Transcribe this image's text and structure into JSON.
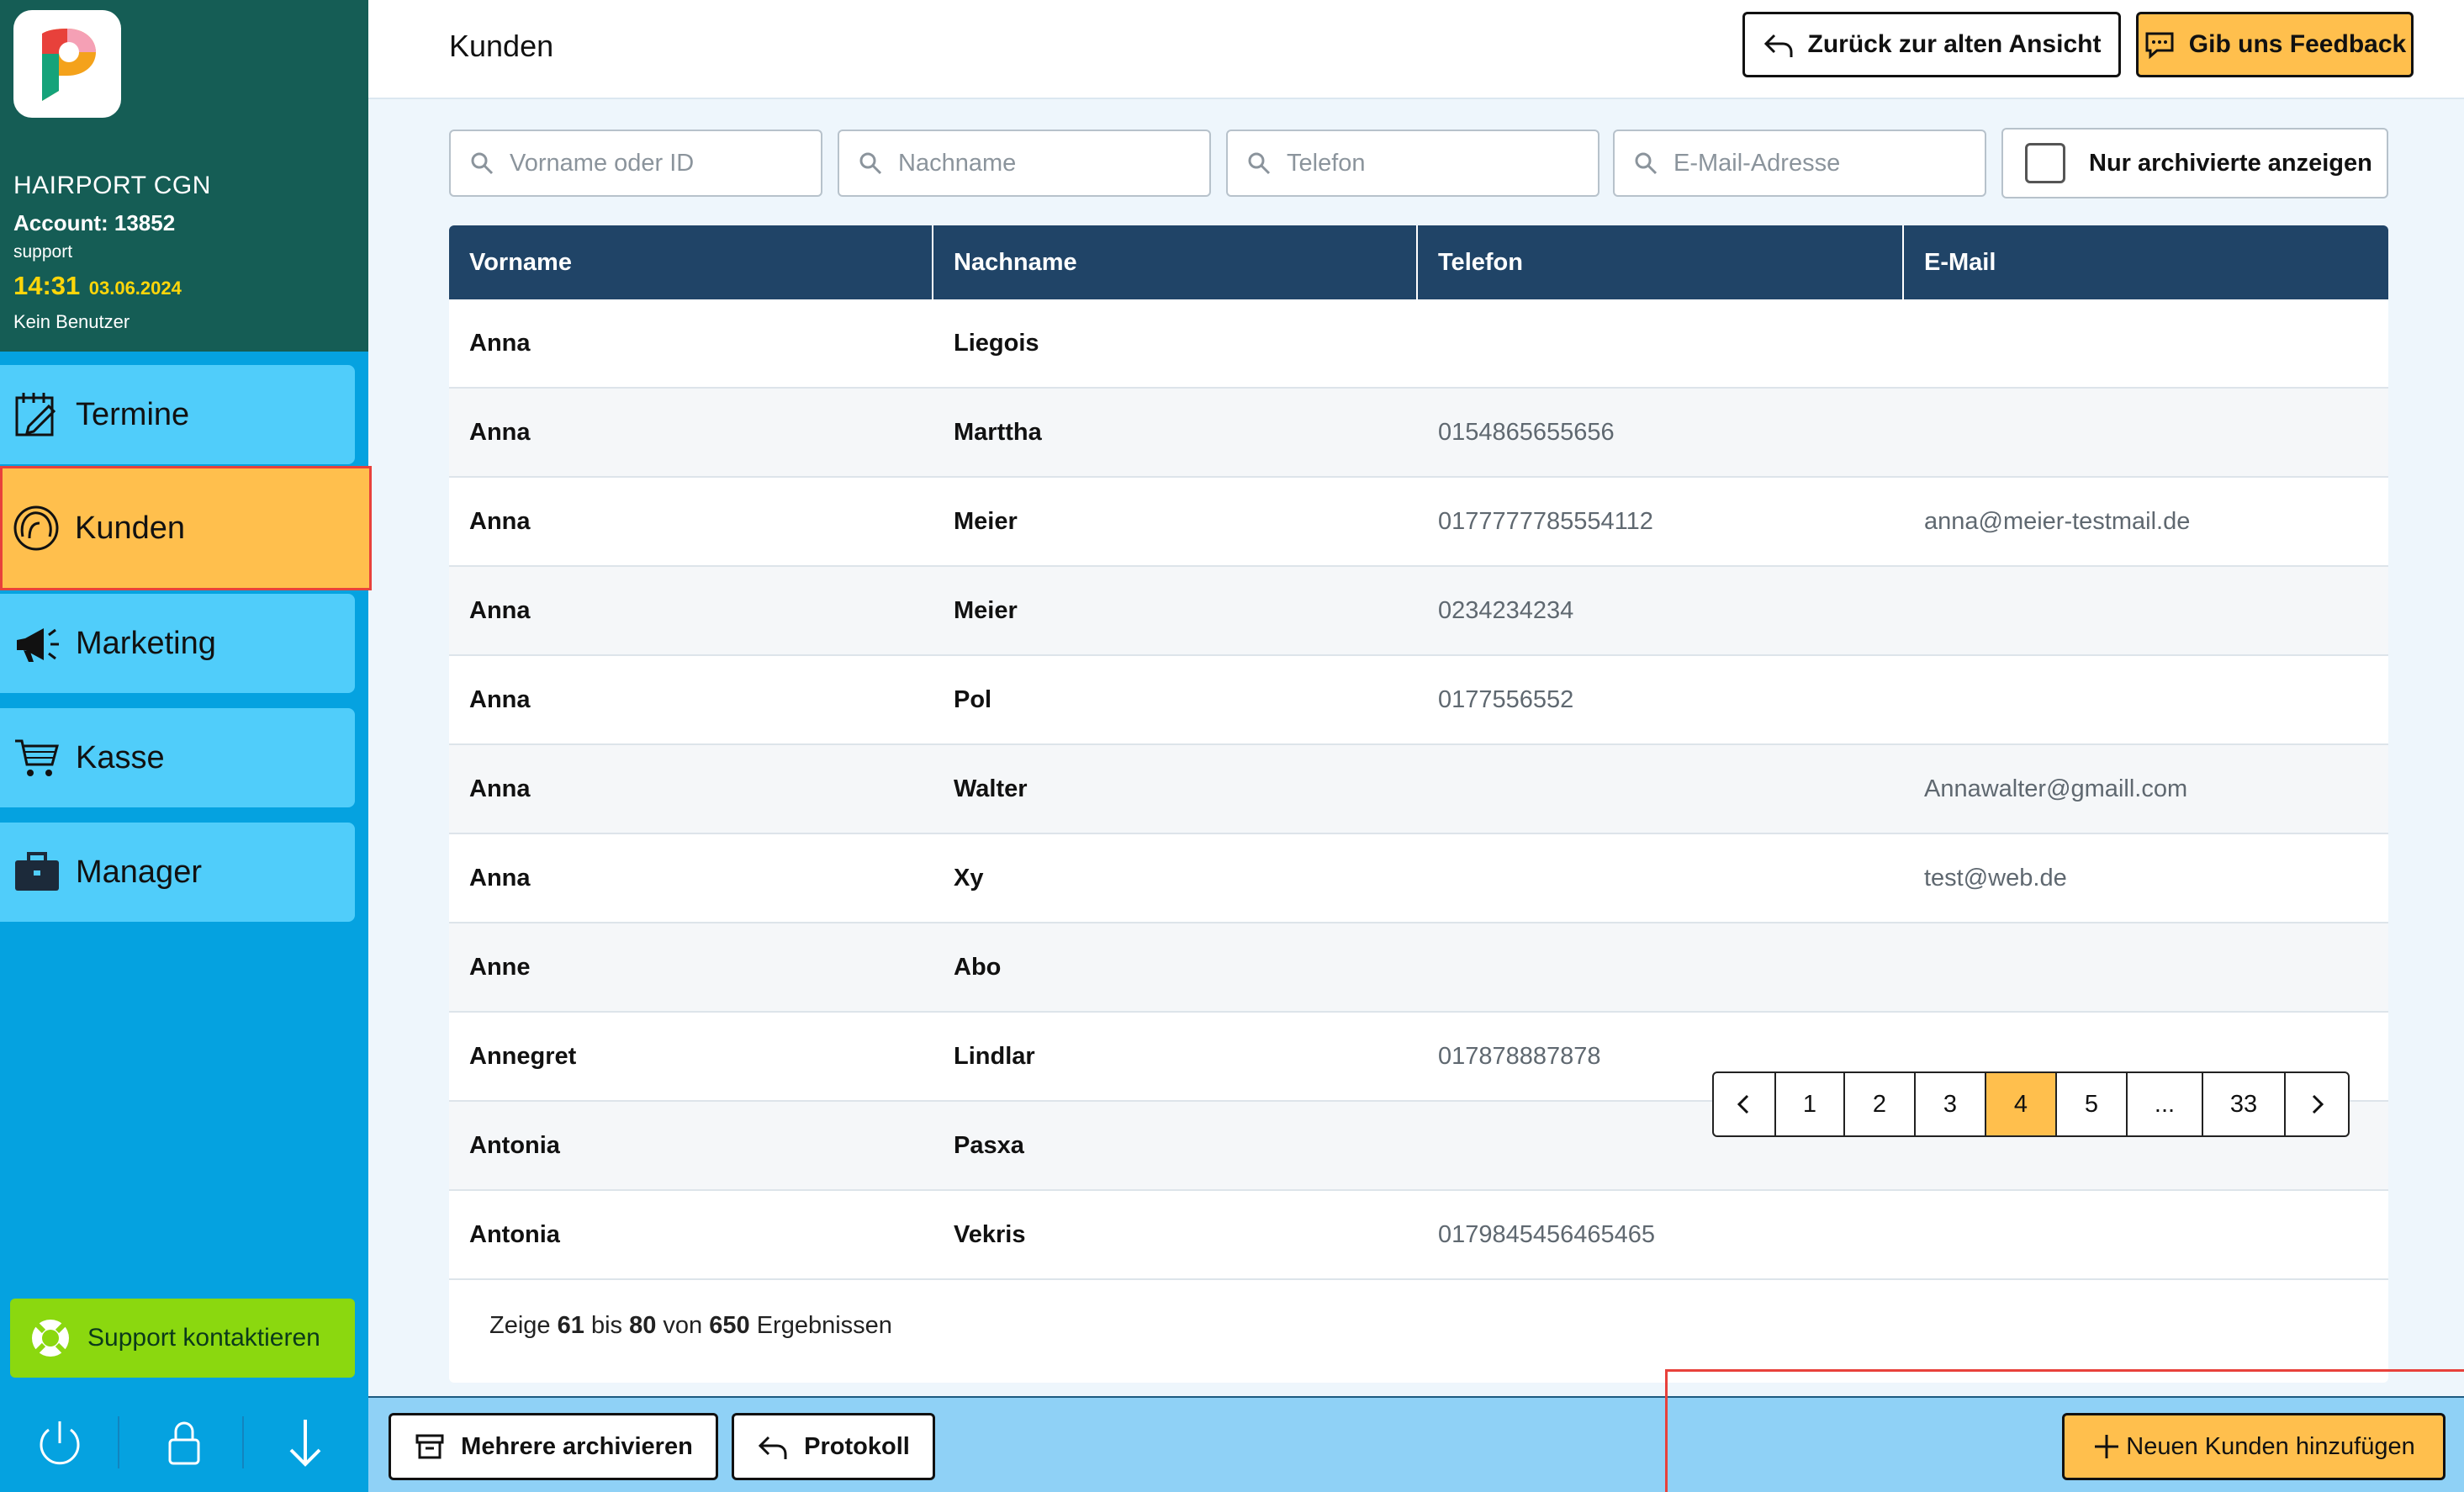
{
  "sidebar": {
    "brand_name": "HAIRPORT CGN",
    "account": "Account: 13852",
    "role": "support",
    "time": "14:31",
    "date": "03.06.2024",
    "user": "Kein Benutzer",
    "nav": {
      "termine": "Termine",
      "kunden": "Kunden",
      "marketing": "Marketing",
      "kasse": "Kasse",
      "manager": "Manager"
    },
    "support_label": "Support kontaktieren"
  },
  "header": {
    "title": "Kunden",
    "back_label": "Zurück zur alten Ansicht",
    "feedback_label": "Gib uns Feedback"
  },
  "filters": {
    "vorname_placeholder": "Vorname oder ID",
    "nachname_placeholder": "Nachname",
    "telefon_placeholder": "Telefon",
    "email_placeholder": "E-Mail-Adresse",
    "archived_label": "Nur archivierte anzeigen"
  },
  "table": {
    "columns": [
      "Vorname",
      "Nachname",
      "Telefon",
      "E-Mail"
    ],
    "rows": [
      {
        "vorname": "Anna",
        "nachname": "Liegois",
        "telefon": "",
        "email": ""
      },
      {
        "vorname": "Anna",
        "nachname": "Marttha",
        "telefon": "0154865655656",
        "email": ""
      },
      {
        "vorname": "Anna",
        "nachname": "Meier",
        "telefon": "0177777785554112",
        "email": "anna@meier-testmail.de"
      },
      {
        "vorname": "Anna",
        "nachname": "Meier",
        "telefon": "0234234234",
        "email": ""
      },
      {
        "vorname": "Anna",
        "nachname": "Pol",
        "telefon": "0177556552",
        "email": ""
      },
      {
        "vorname": "Anna",
        "nachname": "Walter",
        "telefon": "",
        "email": "Annawalter@gmaill.com"
      },
      {
        "vorname": "Anna",
        "nachname": "Xy",
        "telefon": "",
        "email": "test@web.de"
      },
      {
        "vorname": "Anne",
        "nachname": "Abo",
        "telefon": "",
        "email": ""
      },
      {
        "vorname": "Annegret",
        "nachname": "Lindlar",
        "telefon": "017878887878",
        "email": ""
      },
      {
        "vorname": "Antonia",
        "nachname": "Pasxa",
        "telefon": "",
        "email": ""
      },
      {
        "vorname": "Antonia",
        "nachname": "Vekris",
        "telefon": "0179845456465465",
        "email": ""
      }
    ]
  },
  "results": {
    "prefix": "Zeige",
    "from": "61",
    "mid1": "bis",
    "to": "80",
    "mid2": "von",
    "total": "650",
    "suffix": "Ergebnissen"
  },
  "pagination": {
    "pages": [
      "1",
      "2",
      "3",
      "4",
      "5",
      "...",
      "33"
    ],
    "current": "4"
  },
  "actions": {
    "archive_label": "Mehrere archivieren",
    "protocol_label": "Protokoll",
    "add_label": "Neuen Kunden hinzufügen"
  },
  "colors": {
    "brand_dark": "#155d55",
    "sidebar_blue": "#05a2e0",
    "nav_item": "#50cdfa",
    "accent_orange": "#ffbf4d",
    "table_header": "#204467",
    "support_green": "#8bd80f",
    "highlight_red": "#e8413b"
  }
}
